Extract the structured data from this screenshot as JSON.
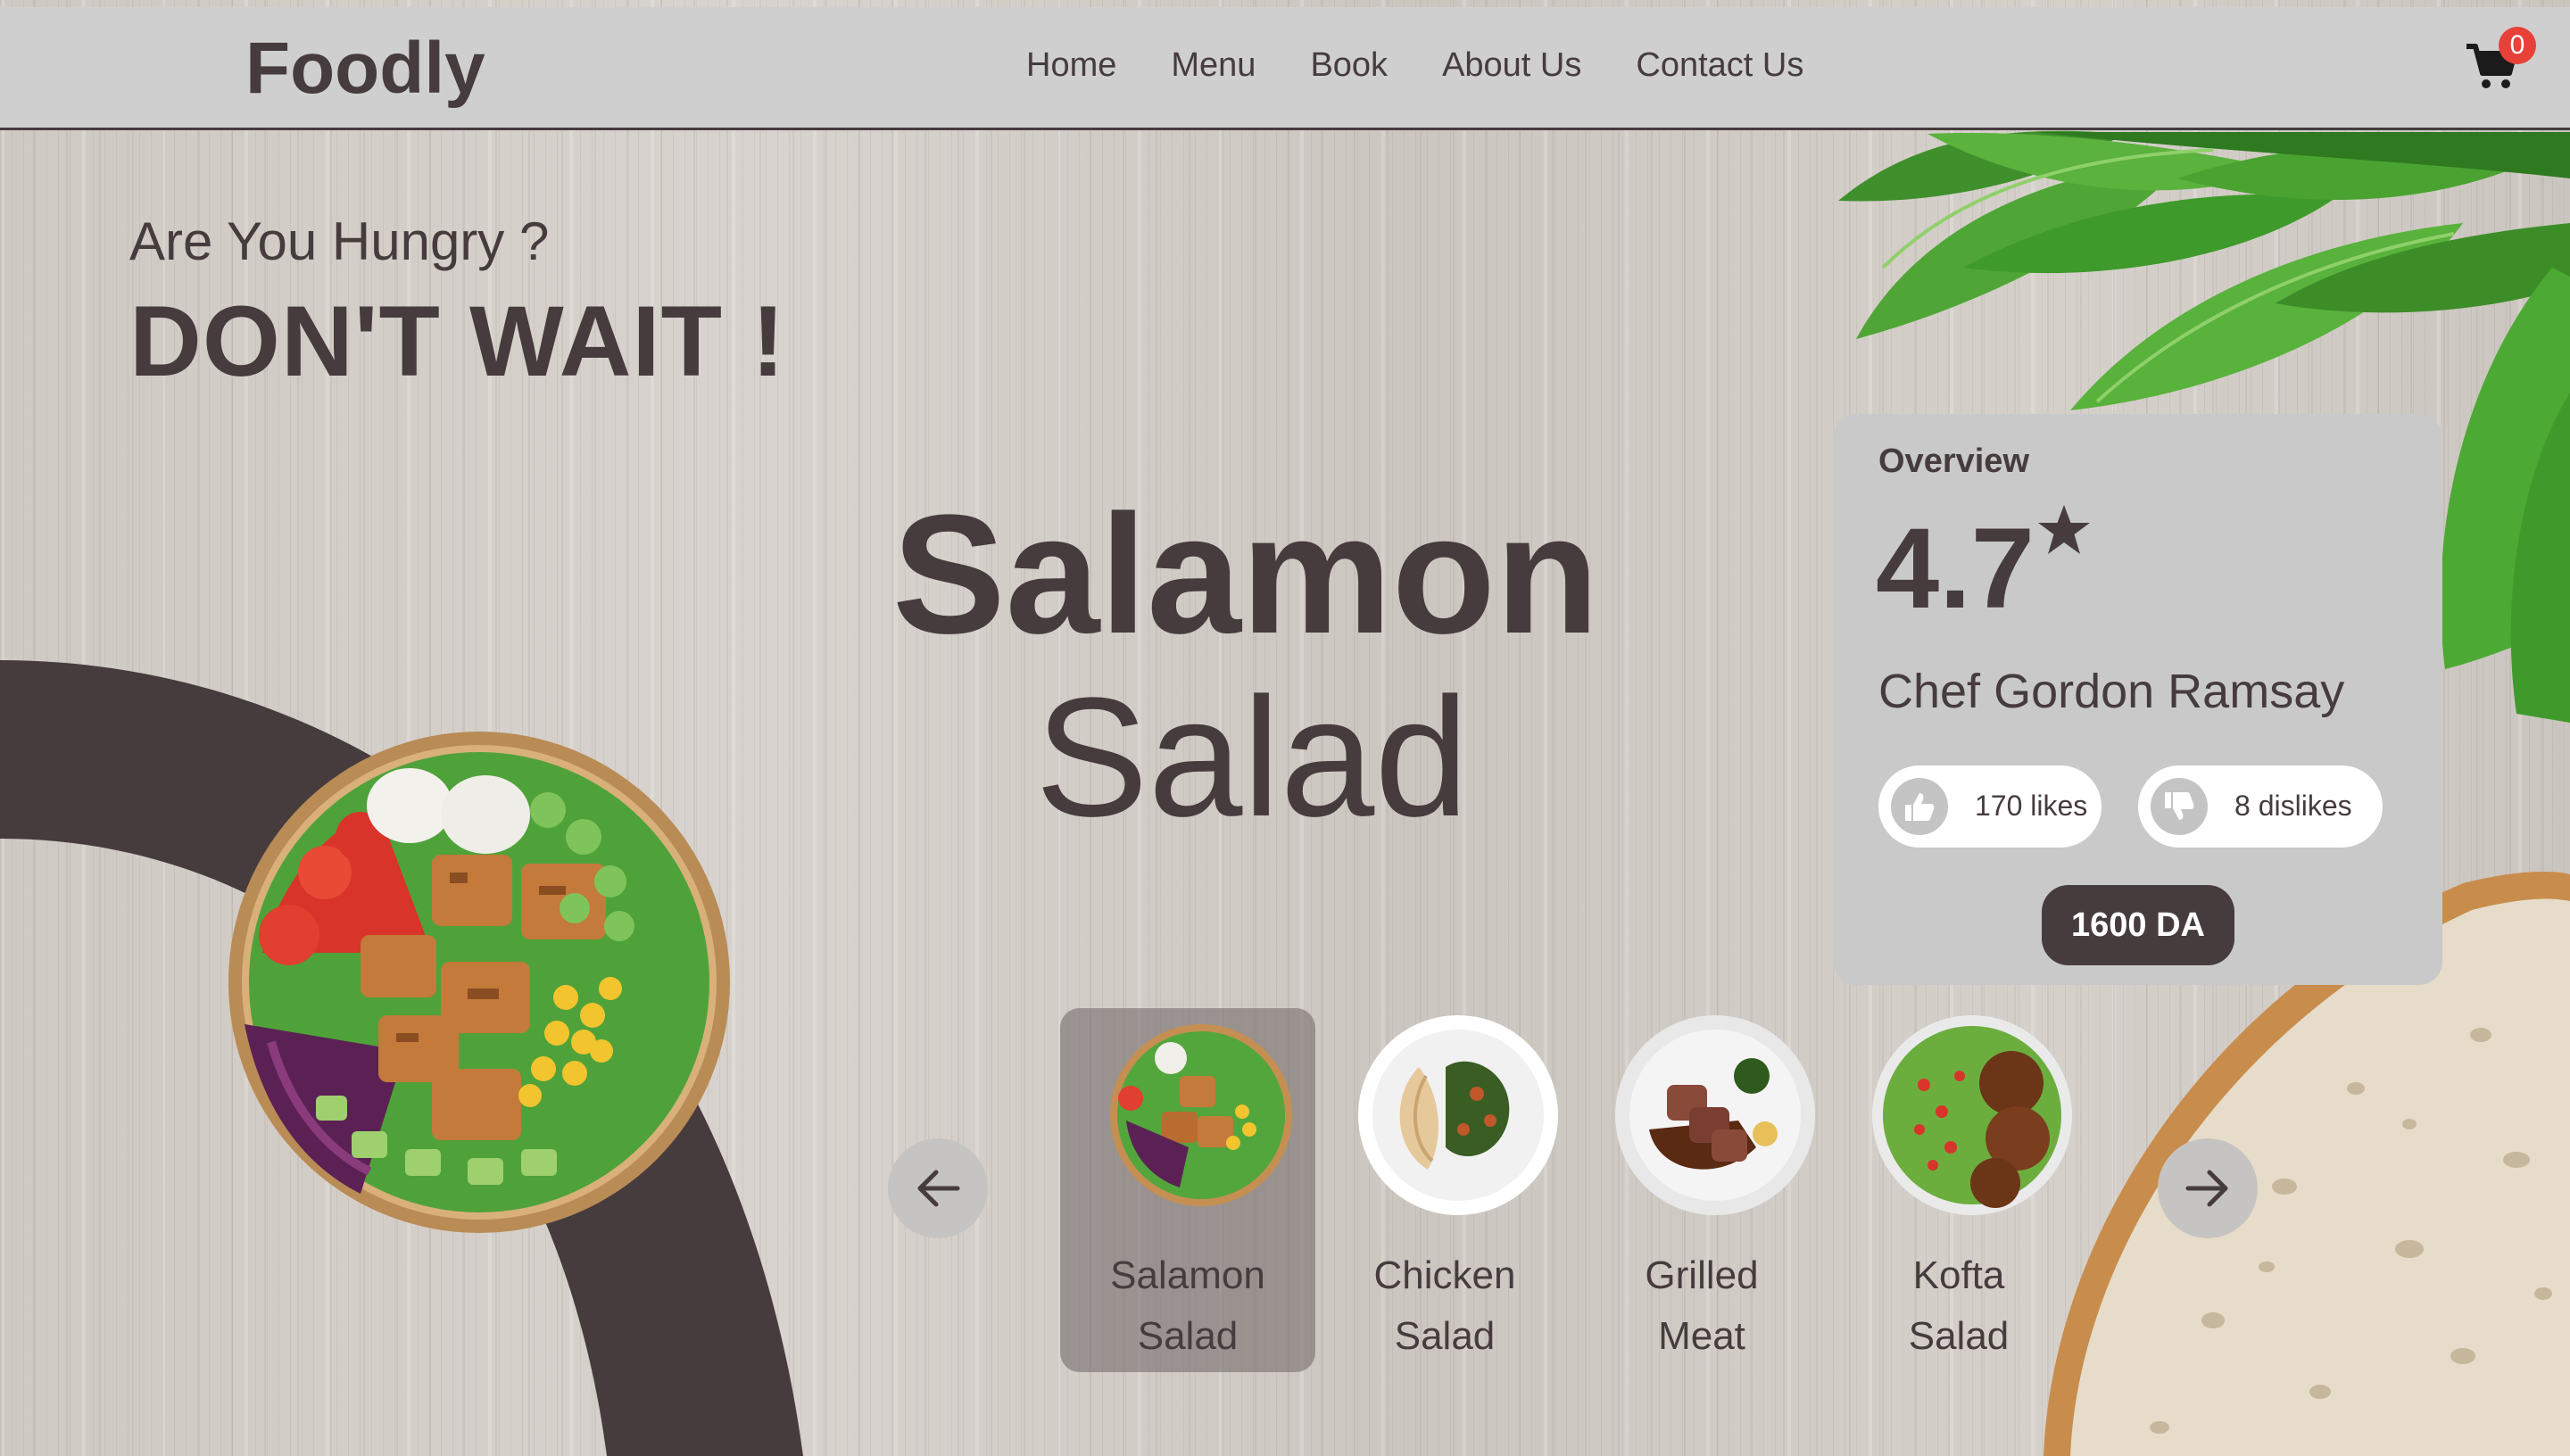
{
  "header": {
    "logo": "Foodly",
    "nav": [
      "Home",
      "Menu",
      "Book",
      "About Us",
      "Contact Us"
    ],
    "cart_icon": "shopping-cart-icon",
    "cart_count": "0"
  },
  "hero": {
    "tagline": "Are You Hungry ?",
    "headline": "DON'T WAIT !",
    "dish_name_bold": "Salamon",
    "dish_name_light": "Salad"
  },
  "overview": {
    "label": "Overview",
    "rating": "4.7",
    "rating_icon": "star-icon",
    "chef": "Chef Gordon Ramsay",
    "likes": "170 likes",
    "dislikes": "8 dislikes",
    "price": "1600 DA"
  },
  "carousel": {
    "prev_icon": "arrow-left-icon",
    "next_icon": "arrow-right-icon",
    "items": [
      {
        "line1": "Salamon",
        "line2": "Salad",
        "active": true
      },
      {
        "line1": "Chicken",
        "line2": "Salad",
        "active": false
      },
      {
        "line1": "Grilled",
        "line2": "Meat",
        "active": false
      },
      {
        "line1": "Kofta",
        "line2": "Salad",
        "active": false
      }
    ]
  },
  "colors": {
    "primary": "#463c3e",
    "header_bg": "#cfcfcf",
    "badge": "#e8413a",
    "card_bg": "#c9c9c9",
    "wood": "#d3cdc8"
  }
}
